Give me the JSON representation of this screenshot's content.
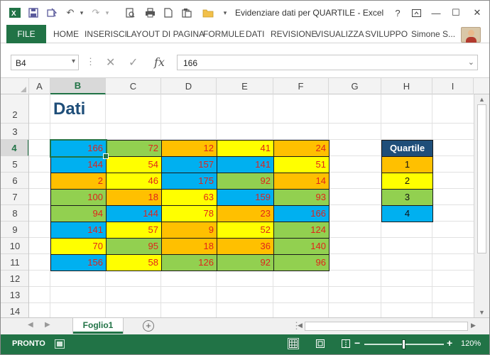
{
  "titlebar": {
    "title": "Evidenziare dati per QUARTILE - Excel",
    "qa_undo": "↶",
    "qa_redo": "↷",
    "qa_customize": "▾",
    "help": "?",
    "restore": "▣",
    "minimize": "—",
    "maximize": "☐",
    "close": "✕"
  },
  "ribbon": {
    "file": "FILE",
    "tabs": [
      "HOME",
      "INSERISCI",
      "LAYOUT DI PAGINA",
      "FORMULE",
      "DATI",
      "REVISIONE",
      "VISUALIZZA",
      "SVILUPPO"
    ],
    "user": "Simone S..."
  },
  "formula_bar": {
    "name_box": "B4",
    "name_arrow": "▾",
    "dots": "⋮",
    "cancel": "✕",
    "enter": "✓",
    "fx": "fx",
    "value": "166",
    "expand": "⌄"
  },
  "columns": [
    "A",
    "B",
    "C",
    "D",
    "E",
    "F",
    "G",
    "H",
    "I"
  ],
  "rows": [
    "2",
    "3",
    "4",
    "5",
    "6",
    "7",
    "8",
    "9",
    "10",
    "11",
    "12",
    "13",
    "14"
  ],
  "selected": {
    "column": "B",
    "row": "4"
  },
  "sheet": {
    "title": "Dati",
    "data": [
      [
        166,
        72,
        12,
        41,
        24
      ],
      [
        144,
        54,
        157,
        141,
        51
      ],
      [
        2,
        46,
        175,
        92,
        14
      ],
      [
        100,
        18,
        63,
        159,
        93
      ],
      [
        94,
        144,
        78,
        23,
        166
      ],
      [
        141,
        57,
        9,
        52,
        124
      ],
      [
        70,
        95,
        18,
        36,
        140
      ],
      [
        156,
        58,
        126,
        92,
        96
      ]
    ],
    "quartile_of_cell": [
      [
        4,
        3,
        1,
        2,
        1
      ],
      [
        4,
        2,
        4,
        4,
        2
      ],
      [
        1,
        2,
        4,
        3,
        1
      ],
      [
        3,
        1,
        2,
        4,
        3
      ],
      [
        3,
        4,
        2,
        1,
        4
      ],
      [
        4,
        2,
        1,
        2,
        3
      ],
      [
        2,
        3,
        1,
        1,
        3
      ],
      [
        4,
        2,
        3,
        3,
        3
      ]
    ],
    "legend_header": "Quartile",
    "legend_values": [
      "1",
      "2",
      "3",
      "4"
    ]
  },
  "colors": {
    "q1": "#ffc000",
    "q2": "#ffff00",
    "q3": "#92d050",
    "q4": "#00b0f0",
    "value_text": "#e0241b",
    "legend_header_bg": "#1f4e79",
    "accent": "#217346"
  },
  "sheet_tabs": {
    "nav_prev": "◀",
    "nav_next": "▶",
    "active": "Foglio1",
    "add": "+",
    "dots": "⋮"
  },
  "statusbar": {
    "status": "PRONTO",
    "view_normal_icon": "grid-icon",
    "view_layout_icon": "page-layout-icon",
    "view_break_icon": "page-break-icon",
    "zoom_minus": "−",
    "zoom_plus": "+",
    "zoom": "120%",
    "zoom_level": 0.5
  }
}
